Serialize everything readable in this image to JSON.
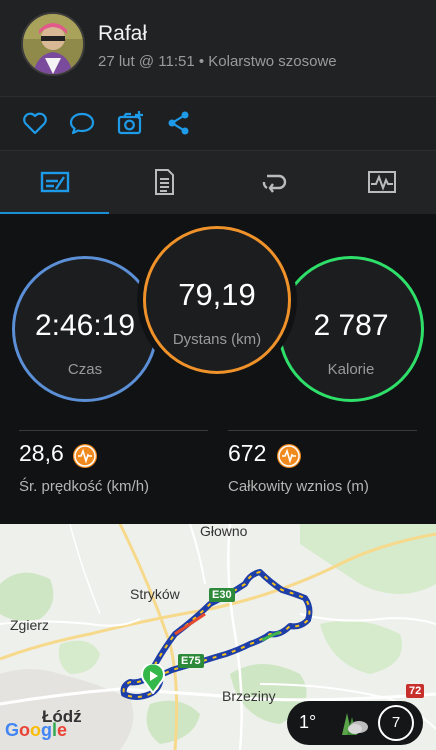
{
  "header": {
    "user_name": "Rafał",
    "meta": "27 lut @ 11:51 • Kolarstwo szosowe"
  },
  "actions": [
    "heart-icon",
    "comment-icon",
    "add-photo-icon",
    "share-icon"
  ],
  "tabs": [
    "overview-tab",
    "details-tab",
    "laps-tab",
    "charts-tab"
  ],
  "stats": {
    "time": {
      "value": "2:46:19",
      "label": "Czas",
      "color": "#5b8fd6"
    },
    "distance": {
      "value": "79,19",
      "label": "Dystans (km)",
      "color": "#f0922a"
    },
    "calories": {
      "value": "2 787",
      "label": "Kalorie",
      "color": "#2ee06a"
    },
    "avg_speed": {
      "value": "28,6",
      "label": "Śr. prędkość (km/h)"
    },
    "elevation": {
      "value": "672",
      "label": "Całkowity wznios (m)"
    }
  },
  "map": {
    "places": {
      "glowno": "Głowno",
      "strykow": "Stryków",
      "zgierz": "Zgierz",
      "brzeziny": "Brzeziny",
      "lodz": "Łódź"
    },
    "roads": {
      "e30": "E30",
      "e75": "E75",
      "r72": "72"
    },
    "weather": {
      "temp": "1°",
      "wind": "7"
    },
    "attribution": "Google"
  },
  "colors": {
    "accent": "#1a8fd6",
    "route": "#1e3ea8",
    "orange": "#f08a1e"
  }
}
